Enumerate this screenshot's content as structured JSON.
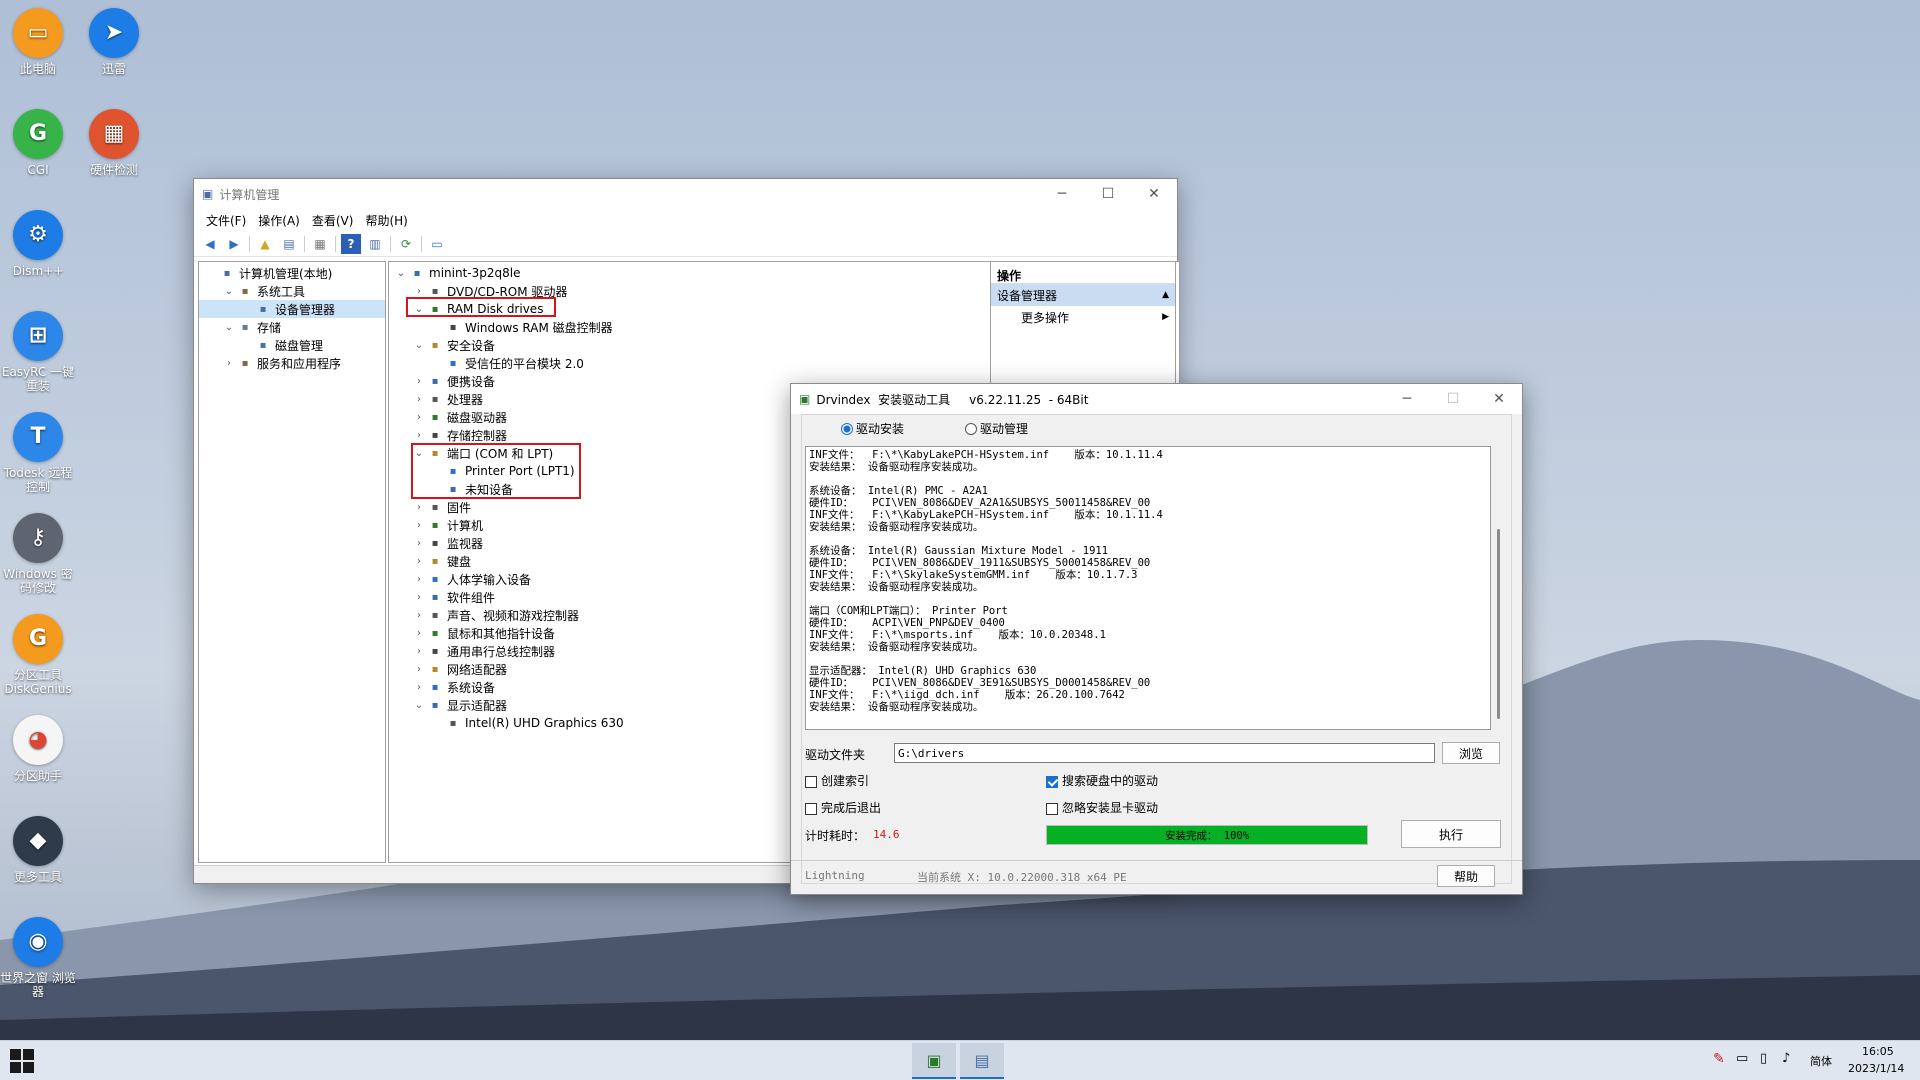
{
  "desktop": {
    "icons": [
      {
        "label": "此电脑",
        "color": "#f39a1f",
        "glyph": "▭"
      },
      {
        "label": "迅雷",
        "color": "#1e7ce6",
        "glyph": "➤"
      },
      {
        "label": "CGI",
        "color": "#37b34a",
        "glyph": "G"
      },
      {
        "label": "硬件检测",
        "color": "#e0532f",
        "glyph": "▦"
      },
      {
        "label": "Dism++",
        "color": "#1e7ce6",
        "glyph": "⚙"
      },
      {
        "label": "EasyRC 一键重装",
        "color": "#2d87e8",
        "glyph": "⊞"
      },
      {
        "label": "Todesk 远程控制",
        "color": "#2d87e8",
        "glyph": "T"
      },
      {
        "label": "Windows 密码修改",
        "color": "#5e6470",
        "glyph": "⚷"
      },
      {
        "label": "分区工具 DiskGenius",
        "color": "#f39a1f",
        "glyph": "G"
      },
      {
        "label": "分区助手",
        "color": "#f5f5f5",
        "glyph": "◕"
      },
      {
        "label": "更多工具",
        "color": "#2f3b4a",
        "glyph": "◆"
      },
      {
        "label": "世界之窗 浏览器",
        "color": "#1e7ce6",
        "glyph": "◉"
      }
    ]
  },
  "cm": {
    "title": "计算机管理",
    "menu": [
      "文件(F)",
      "操作(A)",
      "查看(V)",
      "帮助(H)"
    ],
    "left_tree": [
      {
        "label": "计算机管理(本地)",
        "exp": "",
        "indent": 0,
        "sel": false
      },
      {
        "label": "系统工具",
        "exp": "⌄",
        "indent": 1,
        "sel": false
      },
      {
        "label": "设备管理器",
        "exp": "",
        "indent": 2,
        "sel": true
      },
      {
        "label": "存储",
        "exp": "⌄",
        "indent": 1,
        "sel": false
      },
      {
        "label": "磁盘管理",
        "exp": "",
        "indent": 2,
        "sel": false
      },
      {
        "label": "服务和应用程序",
        "exp": "›",
        "indent": 1,
        "sel": false
      }
    ],
    "device_tree": [
      {
        "label": "minint-3p2q8le",
        "exp": "⌄",
        "indent": 0
      },
      {
        "label": "DVD/CD-ROM 驱动器",
        "exp": "›",
        "indent": 1
      },
      {
        "label": "RAM Disk drives",
        "exp": "⌄",
        "indent": 1
      },
      {
        "label": "Windows RAM 磁盘控制器",
        "exp": "",
        "indent": 2
      },
      {
        "label": "安全设备",
        "exp": "⌄",
        "indent": 1
      },
      {
        "label": "受信任的平台模块 2.0",
        "exp": "",
        "indent": 2
      },
      {
        "label": "便携设备",
        "exp": "›",
        "indent": 1
      },
      {
        "label": "处理器",
        "exp": "›",
        "indent": 1
      },
      {
        "label": "磁盘驱动器",
        "exp": "›",
        "indent": 1
      },
      {
        "label": "存储控制器",
        "exp": "›",
        "indent": 1
      },
      {
        "label": "端口 (COM 和 LPT)",
        "exp": "⌄",
        "indent": 1
      },
      {
        "label": "Printer Port (LPT1)",
        "exp": "",
        "indent": 2
      },
      {
        "label": "未知设备",
        "exp": "",
        "indent": 2
      },
      {
        "label": "固件",
        "exp": "›",
        "indent": 1
      },
      {
        "label": "计算机",
        "exp": "›",
        "indent": 1
      },
      {
        "label": "监视器",
        "exp": "›",
        "indent": 1
      },
      {
        "label": "键盘",
        "exp": "›",
        "indent": 1
      },
      {
        "label": "人体学输入设备",
        "exp": "›",
        "indent": 1
      },
      {
        "label": "软件组件",
        "exp": "›",
        "indent": 1
      },
      {
        "label": "声音、视频和游戏控制器",
        "exp": "›",
        "indent": 1
      },
      {
        "label": "鼠标和其他指针设备",
        "exp": "›",
        "indent": 1
      },
      {
        "label": "通用串行总线控制器",
        "exp": "›",
        "indent": 1
      },
      {
        "label": "网络适配器",
        "exp": "›",
        "indent": 1
      },
      {
        "label": "系统设备",
        "exp": "›",
        "indent": 1
      },
      {
        "label": "显示适配器",
        "exp": "⌄",
        "indent": 1
      },
      {
        "label": "Intel(R) UHD Graphics 630",
        "exp": "",
        "indent": 2
      }
    ],
    "actions": {
      "header": "操作",
      "section": "设备管理器",
      "more": "更多操作"
    }
  },
  "drv": {
    "title": "Drvindex  安装驱动工具     v6.22.11.25  - 64Bit",
    "mode_install": "驱动安装",
    "mode_manage": "驱动管理",
    "log": "INF文件：  F:\\*\\KabyLakePCH-HSystem.inf    版本：10.1.11.4\n安装结果： 设备驱动程序安装成功。\n\n系统设备： Intel(R) PMC - A2A1\n硬件ID：   PCI\\VEN_8086&DEV_A2A1&SUBSYS_50011458&REV_00\nINF文件：  F:\\*\\KabyLakePCH-HSystem.inf    版本：10.1.11.4\n安装结果： 设备驱动程序安装成功。\n\n系统设备： Intel(R) Gaussian Mixture Model - 1911\n硬件ID：   PCI\\VEN_8086&DEV_1911&SUBSYS_50001458&REV_00\nINF文件：  F:\\*\\SkylakeSystemGMM.inf    版本：10.1.7.3\n安装结果： 设备驱动程序安装成功。\n\n端口（COM和LPT端口）： Printer Port\n硬件ID：   ACPI\\VEN_PNP&DEV_0400\nINF文件：  F:\\*\\msports.inf    版本：10.0.20348.1\n安装结果： 设备驱动程序安装成功。\n\n显示适配器： Intel(R) UHD Graphics 630\n硬件ID：   PCI\\VEN_8086&DEV_3E91&SUBSYS_D0001458&REV_00\nINF文件：  F:\\*\\iigd_dch.inf    版本：26.20.100.7642\n安装结果： 设备驱动程序安装成功。",
    "folder_label": "驱动文件夹",
    "folder_value": "G:\\drivers",
    "browse": "浏览",
    "opt_index": "创建索引",
    "opt_exit": "完成后退出",
    "opt_search": "搜索硬盘中的驱动",
    "opt_ignore": "忽略安装显卡驱动",
    "time_label": "计时耗时：",
    "time_value": "14.6",
    "progress_text": "安装完成： 100%",
    "progress": 1.0,
    "run": "执行",
    "status_left": "Lightning",
    "status_sys": "当前系统 X: 10.0.22000.318 x64  PE",
    "help": "帮助"
  },
  "taskbar": {
    "time": "16:05",
    "date": "2023/1/14",
    "ime": "简体"
  }
}
